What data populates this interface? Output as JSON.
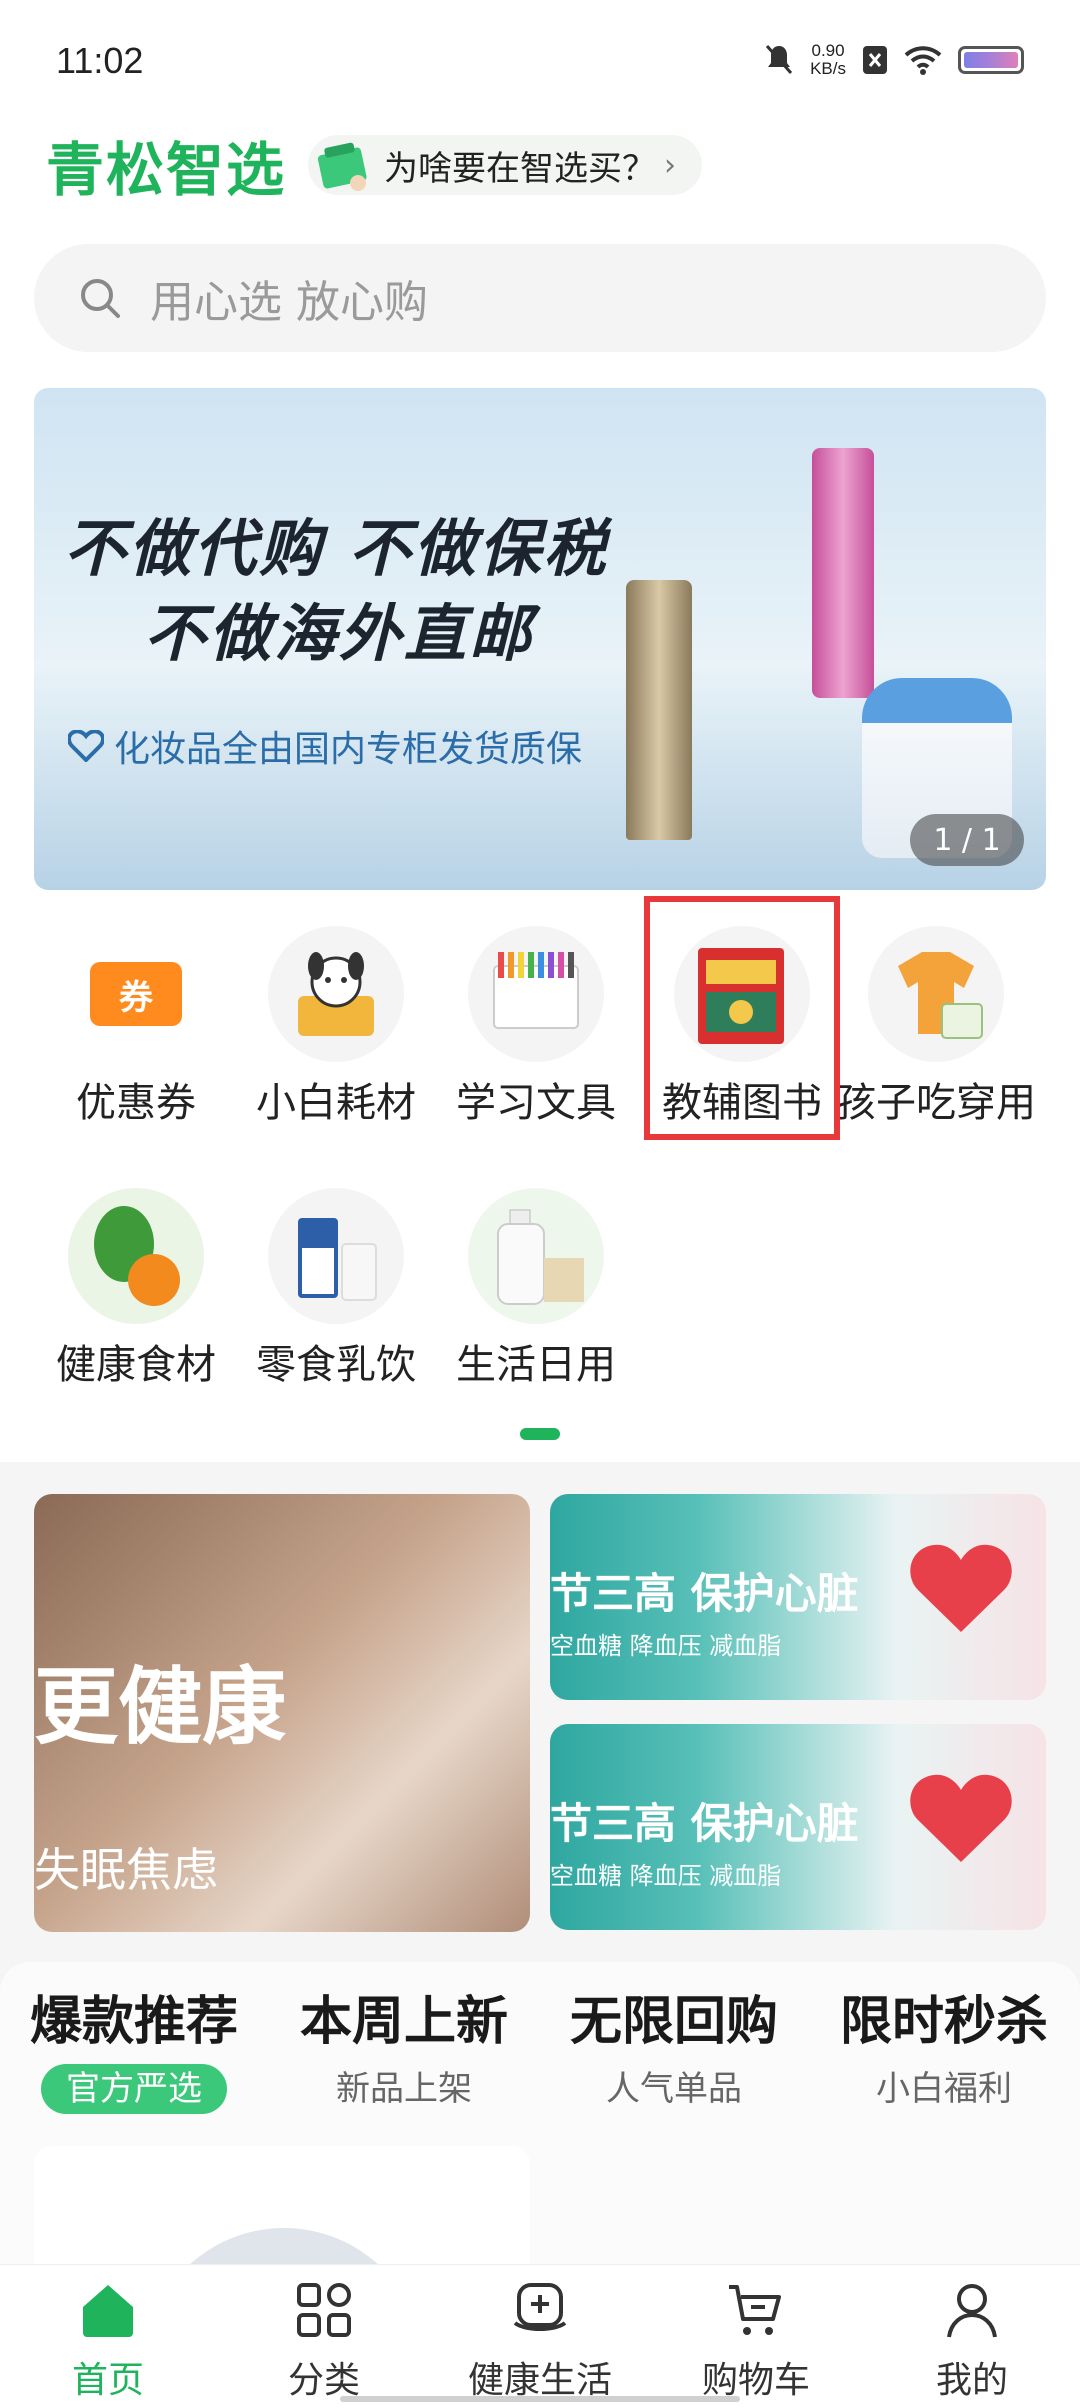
{
  "status_bar": {
    "time": "11:02",
    "net_speed_value": "0.90",
    "net_speed_unit": "KB/s"
  },
  "header": {
    "logo": "青松智选",
    "promo": "为啥要在智选买？"
  },
  "search": {
    "placeholder": "用心选 放心购"
  },
  "banner": {
    "slogan_line1": "不做代购 不做保税",
    "slogan_line2": "不做海外直邮",
    "subtitle": "化妆品全由国内专柜发货质保",
    "counter": "1 / 1"
  },
  "categories": [
    {
      "label": "优惠券",
      "icon": "coupon-icon",
      "tag": "券"
    },
    {
      "label": "小白耗材",
      "icon": "pet-supplies-icon"
    },
    {
      "label": "学习文具",
      "icon": "stationery-icon"
    },
    {
      "label": "教辅图书",
      "icon": "book-icon"
    },
    {
      "label": "孩子吃穿用",
      "icon": "kids-clothing-icon"
    },
    {
      "label": "健康食材",
      "icon": "vegetable-icon"
    },
    {
      "label": "零食乳饮",
      "icon": "milk-icon"
    },
    {
      "label": "生活日用",
      "icon": "daily-goods-icon"
    }
  ],
  "health_banners": {
    "big": {
      "title": "更健康",
      "subtitle": "失眠焦虑"
    },
    "small": [
      {
        "title": "节三高 保护心脏",
        "subtitle": "空血糖 降血压 减血脂"
      },
      {
        "title": "节三高 保护心脏",
        "subtitle": "空血糖 降血压 减血脂"
      }
    ]
  },
  "feature_tabs": [
    {
      "title": "爆款推荐",
      "subtitle": "官方严选",
      "active": true
    },
    {
      "title": "本周上新",
      "subtitle": "新品上架",
      "active": false
    },
    {
      "title": "无限回购",
      "subtitle": "人气单品",
      "active": false
    },
    {
      "title": "限时秒杀",
      "subtitle": "小白福利",
      "active": false
    }
  ],
  "bottom_nav": [
    {
      "label": "首页",
      "icon": "home-icon",
      "active": true
    },
    {
      "label": "分类",
      "icon": "category-grid-icon",
      "active": false
    },
    {
      "label": "健康生活",
      "icon": "health-life-icon",
      "active": false
    },
    {
      "label": "购物车",
      "icon": "shopping-cart-icon",
      "active": false
    },
    {
      "label": "我的",
      "icon": "profile-icon",
      "active": false
    }
  ],
  "colors": {
    "brand_green": "#1fb35c",
    "highlight_red": "#e8383b",
    "coupon_orange": "#ff8a1e"
  }
}
